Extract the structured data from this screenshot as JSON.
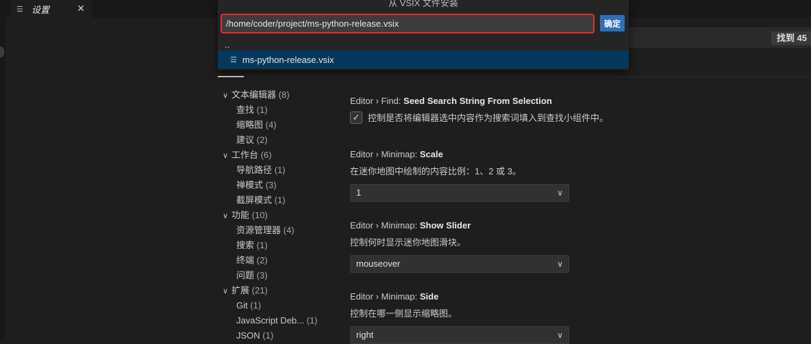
{
  "tab": {
    "label": "设置",
    "icon": "list-icon",
    "close": "✕"
  },
  "dialog": {
    "title": "从 VSIX 文件安装",
    "input_value": "/home/coder/project/ms-python-release.vsix",
    "ok_label": "确定",
    "items": [
      {
        "label": "..",
        "icon": ""
      },
      {
        "label": "ms-python-release.vsix",
        "icon": "file-icon"
      }
    ]
  },
  "search": {
    "found": "找到 45"
  },
  "toc": {
    "groups": [
      {
        "label": "文本编辑器",
        "count": "(8)",
        "children": [
          {
            "label": "查找",
            "count": "(1)"
          },
          {
            "label": "缩略图",
            "count": "(4)"
          },
          {
            "label": "建议",
            "count": "(2)"
          }
        ]
      },
      {
        "label": "工作台",
        "count": "(6)",
        "children": [
          {
            "label": "导航路径",
            "count": "(1)"
          },
          {
            "label": "禅模式",
            "count": "(3)"
          },
          {
            "label": "截屏模式",
            "count": "(1)"
          }
        ]
      },
      {
        "label": "功能",
        "count": "(10)",
        "children": [
          {
            "label": "资源管理器",
            "count": "(4)"
          },
          {
            "label": "搜索",
            "count": "(1)"
          },
          {
            "label": "终端",
            "count": "(2)"
          },
          {
            "label": "问题",
            "count": "(3)"
          }
        ]
      },
      {
        "label": "扩展",
        "count": "(21)",
        "children": [
          {
            "label": "Git",
            "count": "(1)"
          },
          {
            "label": "JavaScript Deb...",
            "count": "(1)"
          },
          {
            "label": "JSON",
            "count": "(1)"
          }
        ]
      }
    ]
  },
  "settings": [
    {
      "prefix": "Editor › Find: ",
      "name": "Seed Search String From Selection",
      "type": "checkbox",
      "checked": true,
      "description": "控制是否将编辑器选中内容作为搜索词填入到查找小组件中。"
    },
    {
      "prefix": "Editor › Minimap: ",
      "name": "Scale",
      "type": "select",
      "description": "在迷你地图中绘制的内容比例：1、2 或 3。",
      "value": "1"
    },
    {
      "prefix": "Editor › Minimap: ",
      "name": "Show Slider",
      "type": "select",
      "description": "控制何时显示迷你地图滑块。",
      "value": "mouseover"
    },
    {
      "prefix": "Editor › Minimap: ",
      "name": "Side",
      "type": "select",
      "description": "控制在哪一侧显示缩略图。",
      "value": "right"
    }
  ]
}
